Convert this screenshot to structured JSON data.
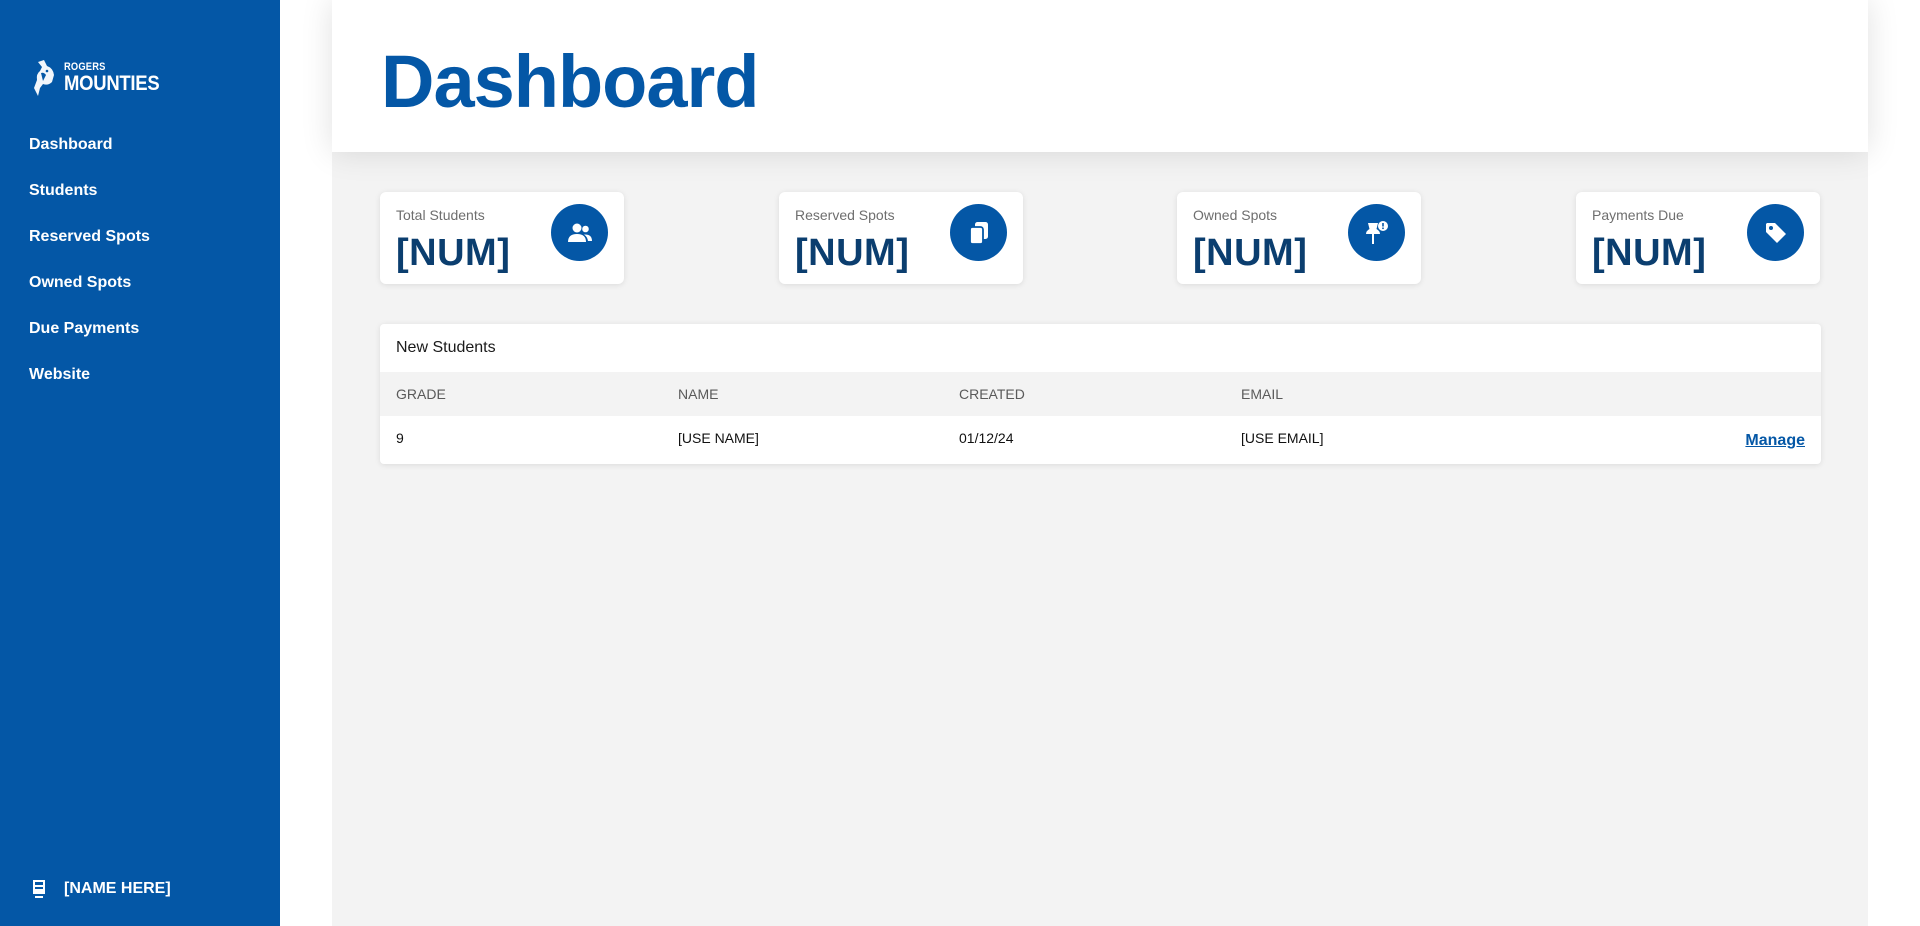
{
  "sidebar": {
    "logo_small": "ROGERS",
    "logo_big": "MOUNTIES",
    "items": [
      {
        "label": "Dashboard"
      },
      {
        "label": "Students"
      },
      {
        "label": "Reserved Spots"
      },
      {
        "label": "Owned Spots"
      },
      {
        "label": "Due Payments"
      },
      {
        "label": "Website"
      }
    ],
    "user_name": "[NAME HERE]"
  },
  "header": {
    "title": "Dashboard"
  },
  "stats": [
    {
      "label": "Total Students",
      "value": "[NUM]",
      "icon": "users-icon"
    },
    {
      "label": "Reserved Spots",
      "value": "[NUM]",
      "icon": "copy-icon"
    },
    {
      "label": "Owned Spots",
      "value": "[NUM]",
      "icon": "push-pin-icon"
    },
    {
      "label": "Payments Due",
      "value": "[NUM]",
      "icon": "tag-icon"
    }
  ],
  "new_students": {
    "title": "New Students",
    "columns": [
      "GRADE",
      "NAME",
      "CREATED",
      "EMAIL"
    ],
    "rows": [
      {
        "grade": "9",
        "name": "[USE NAME]",
        "created": "01/12/24",
        "email": "[USE EMAIL]",
        "action": "Manage"
      }
    ]
  },
  "colors": {
    "brand_blue": "#0457a6",
    "value_navy": "#0b3e6f",
    "page_bg": "#f3f3f3"
  }
}
